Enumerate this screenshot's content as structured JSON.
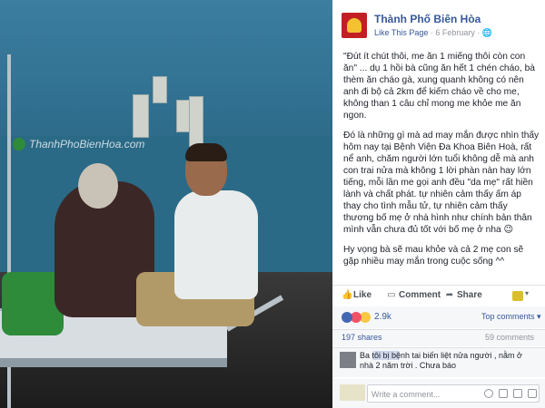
{
  "photo": {
    "watermark": "ThanhPhoBienHoa.com"
  },
  "post": {
    "page_name": "Thành Phố Biên Hòa",
    "like_page": "Like This Page",
    "date": " · 6 February · ",
    "paragraphs": [
      "\"Đút ít chút thôi, me ăn 1 miếng thôi còn con ăn\" ... dụ 1 hồi bà cũng ăn hết 1 chén cháo, bà thèm ăn cháo gà, xung quanh không có nên anh đi bộ cả 2km để kiếm cháo về cho me, không than 1 câu chỉ mong me khỏe me ăn ngon.",
      "Đó là những gì mà ad may mắn được nhìn thấy hôm nay tại Bệnh Viện Đa Khoa Biên Hoà, rất nể anh, chăm người lớn tuổi không dễ mà anh con trai nửa mà không 1 lời phàn nàn hay lớn tiếng, mỗi lần me gọi anh đều \"da mẹ\" rất hiền lành và chất phát. tự nhiên cảm thấy ấm áp thay cho tình mẫu tử, tự nhiên cảm thấy thương bố mẹ ở nhà hình như chính bản thân mình vẫn chưa đủ tốt với bố mẹ ở nha 😉",
      "Hy vọng bà sẽ mau khỏe và cả 2 mẹ con sẽ gặp nhiều may mắn trong cuộc sống ^^"
    ]
  },
  "actions": {
    "like": "Like",
    "comment": "Comment",
    "share": "Share"
  },
  "reactions": {
    "count": "2.9k",
    "top_comments": "Top comments ▾"
  },
  "stats": {
    "shares": "197 shares",
    "comments": "59 comments"
  },
  "comment": {
    "text": "Ba tôi bị bệnh tai biến liệt nửa người , nằm ở nhà 2 năm trời . Chưa báo"
  },
  "write": {
    "placeholder": "Write a comment..."
  },
  "colors": {
    "link": "#365899",
    "brand_red": "#c31e24"
  }
}
